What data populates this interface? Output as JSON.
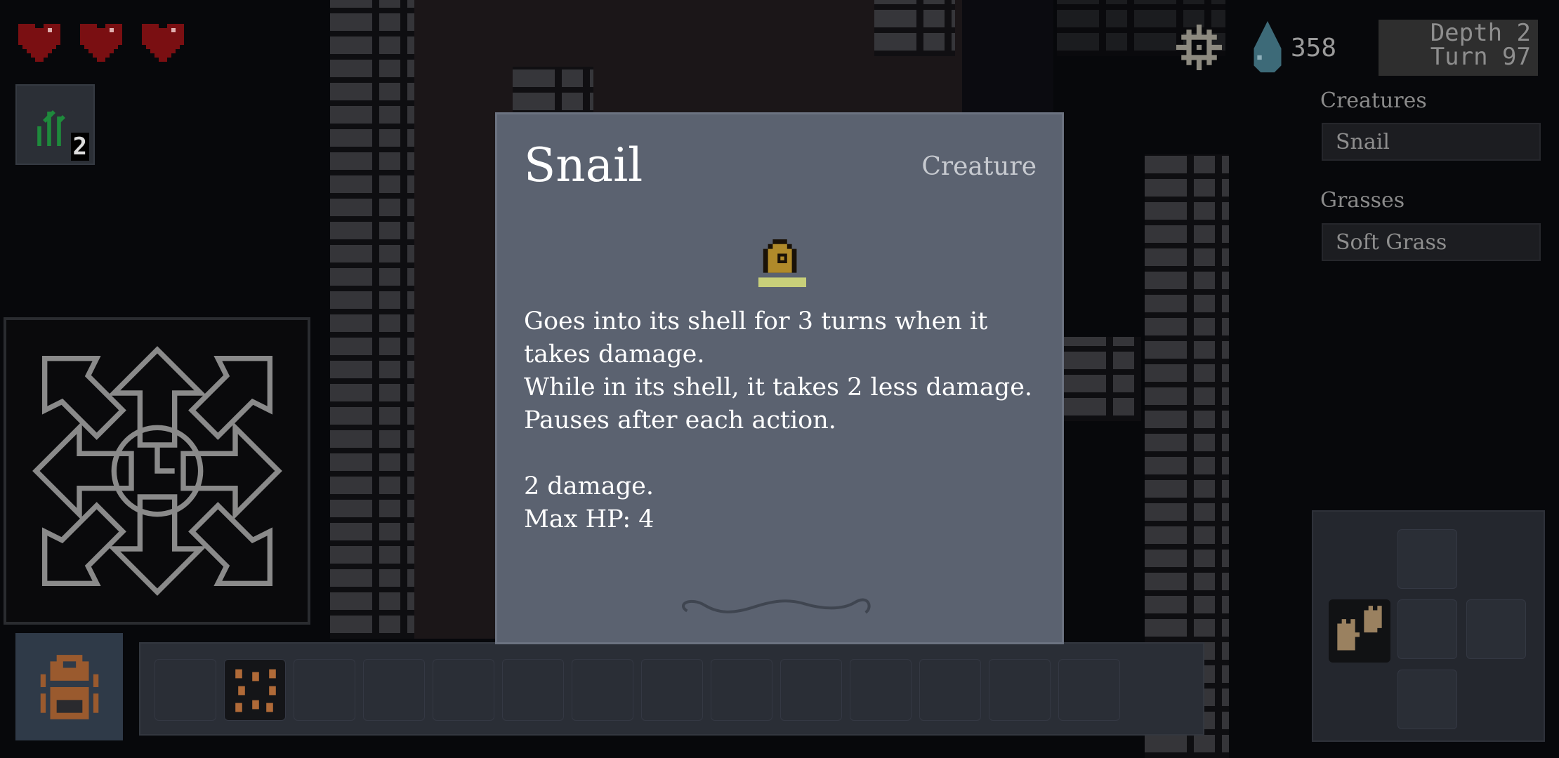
{
  "hud": {
    "hearts": 3,
    "grass_count": "2",
    "water": "358",
    "depth": "Depth 2",
    "turn": "Turn 97"
  },
  "modal": {
    "title": "Snail",
    "kind": "Creature",
    "description": [
      "Goes into its shell for 3 turns when it takes damage.",
      "While in its shell, it takes 2 less damage.",
      "Pauses after each action.",
      "",
      "2 damage.",
      "Max HP: 4"
    ]
  },
  "sidebar": {
    "sections": [
      {
        "label": "Creatures",
        "items": [
          "Snail"
        ]
      },
      {
        "label": "Grasses",
        "items": [
          "Soft Grass"
        ]
      }
    ]
  },
  "hotbar": {
    "slots": 14,
    "filled_slot": 1,
    "filled_icon": "seeds-icon"
  },
  "colors": {
    "modal_bg": "#5b6270",
    "heart": "#7a0f12",
    "water": "#3d6a78",
    "backpack": "#9a5a2e"
  }
}
